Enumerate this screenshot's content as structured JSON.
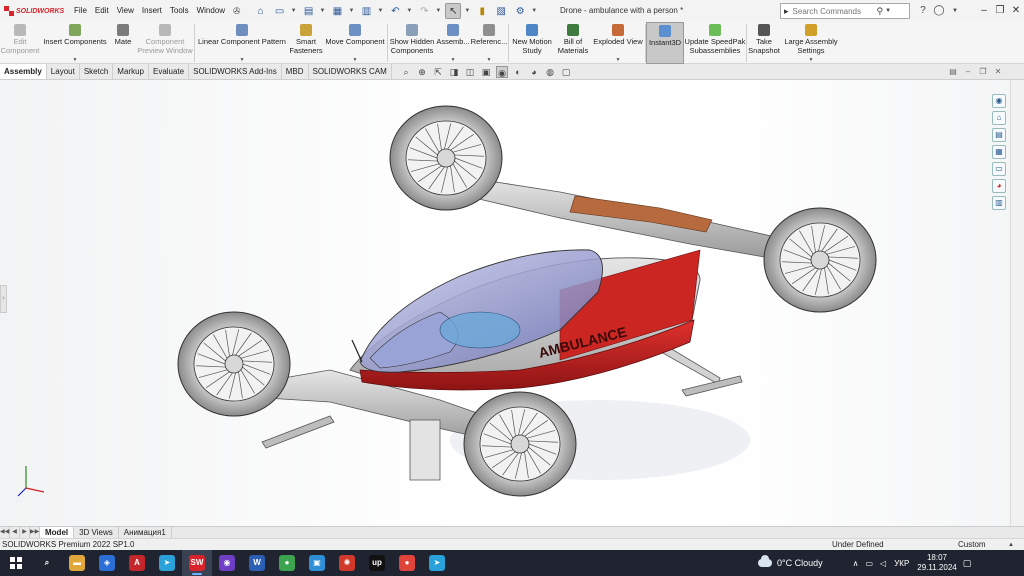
{
  "app": {
    "logo_text": "SOLIDWORKS",
    "document_title": "Drone - ambulance with a person *",
    "menu": [
      "File",
      "Edit",
      "View",
      "Insert",
      "Tools",
      "Window"
    ],
    "search_placeholder": "Search Commands"
  },
  "ribbon": [
    {
      "name": "edit-component-button",
      "label": "Edit\nComponent",
      "icon": "edit-component-icon",
      "color": "#b9b9b9",
      "disabled": true,
      "caret": false,
      "width": 40
    },
    {
      "name": "insert-components-button",
      "label": "Insert Components",
      "icon": "insert-components-icon",
      "color": "#7fa65a",
      "disabled": false,
      "caret": true,
      "width": 70
    },
    {
      "name": "mate-button",
      "label": "Mate",
      "icon": "mate-icon",
      "color": "#7c7c7c",
      "disabled": false,
      "caret": false,
      "width": 26
    },
    {
      "name": "component-preview-button",
      "label": "Component\nPreview Window",
      "icon": "preview-window-icon",
      "color": "#b9b9b9",
      "disabled": true,
      "caret": false,
      "width": 58
    },
    {
      "name": "linear-pattern-button",
      "label": "Linear Component Pattern",
      "icon": "linear-pattern-icon",
      "color": "#6f8fbf",
      "disabled": false,
      "caret": true,
      "width": 94
    },
    {
      "name": "smart-fasteners-button",
      "label": "Smart\nFasteners",
      "icon": "fasteners-icon",
      "color": "#c9a23a",
      "disabled": false,
      "caret": false,
      "width": 34
    },
    {
      "name": "move-component-button",
      "label": "Move Component",
      "icon": "move-component-icon",
      "color": "#6c8fc4",
      "disabled": false,
      "caret": true,
      "width": 64
    },
    {
      "name": "show-hidden-button",
      "label": "Show Hidden\nComponents",
      "icon": "show-hidden-icon",
      "color": "#8aa0b8",
      "disabled": false,
      "caret": false,
      "width": 48
    },
    {
      "name": "assembly-features-button",
      "label": "Assemb...",
      "icon": "assembly-features-icon",
      "color": "#6c8fc4",
      "disabled": false,
      "caret": true,
      "width": 34
    },
    {
      "name": "reference-geometry-button",
      "label": "Referenc...",
      "icon": "reference-geometry-icon",
      "color": "#8f8f8f",
      "disabled": false,
      "caret": true,
      "width": 38
    },
    {
      "name": "new-motion-study-button",
      "label": "New Motion\nStudy",
      "icon": "motion-study-icon",
      "color": "#4f86c6",
      "disabled": false,
      "caret": false,
      "width": 46
    },
    {
      "name": "bill-of-materials-button",
      "label": "Bill of\nMaterials",
      "icon": "bom-icon",
      "color": "#3f7a3f",
      "disabled": false,
      "caret": false,
      "width": 36
    },
    {
      "name": "exploded-view-button",
      "label": "Exploded View",
      "icon": "exploded-view-icon",
      "color": "#c66a3a",
      "disabled": false,
      "caret": true,
      "width": 54
    },
    {
      "name": "instant3d-button",
      "label": "Instant3D",
      "icon": "instant3d-icon",
      "color": "#5a8fd0",
      "disabled": false,
      "caret": false,
      "active": true,
      "width": 38
    },
    {
      "name": "update-speedpak-button",
      "label": "Update SpeedPak\nSubassemblies",
      "icon": "speedpak-icon",
      "color": "#6bbd57",
      "disabled": false,
      "caret": false,
      "width": 62
    },
    {
      "name": "take-snapshot-button",
      "label": "Take\nSnapshot",
      "icon": "snapshot-icon",
      "color": "#555",
      "disabled": false,
      "caret": false,
      "width": 34
    },
    {
      "name": "large-assembly-settings-button",
      "label": "Large Assembly\nSettings",
      "icon": "large-assembly-icon",
      "color": "#d1a02a",
      "disabled": false,
      "caret": true,
      "width": 60
    }
  ],
  "tabs": [
    "Assembly",
    "Layout",
    "Sketch",
    "Markup",
    "Evaluate",
    "SOLIDWORKS Add-Ins",
    "MBD",
    "SOLIDWORKS CAM"
  ],
  "active_tab": "Assembly",
  "model": {
    "livery_text": "AMBULANCE"
  },
  "bottom_tabs": [
    "Model",
    "3D Views",
    "Анимация1"
  ],
  "active_bottom_tab": "Model",
  "status": {
    "product": "SOLIDWORKS Premium 2022 SP1.0",
    "state": "Under Defined",
    "units": "Custom"
  },
  "taskbar": {
    "apps": [
      {
        "name": "search-taskbar-icon",
        "glyph": "⌕",
        "color": "transparent"
      },
      {
        "name": "file-explorer-icon",
        "glyph": "▬",
        "color": "#e0a83a"
      },
      {
        "name": "defender-icon",
        "glyph": "◈",
        "color": "#2b6fd6"
      },
      {
        "name": "acrobat-icon",
        "glyph": "A",
        "color": "#c3272b"
      },
      {
        "name": "telegram-icon",
        "glyph": "➤",
        "color": "#2aa1d8"
      },
      {
        "name": "solidworks-taskbar-icon",
        "glyph": "SW",
        "color": "#d9232a",
        "active": true
      },
      {
        "name": "app-purple-icon",
        "glyph": "◉",
        "color": "#6e3fc4"
      },
      {
        "name": "word-icon",
        "glyph": "W",
        "color": "#2b5fb4"
      },
      {
        "name": "chrome-icon",
        "glyph": "●",
        "color": "#3ca450"
      },
      {
        "name": "app-blue-icon",
        "glyph": "▣",
        "color": "#2e8fd6"
      },
      {
        "name": "app-red-icon",
        "glyph": "✺",
        "color": "#d13a2a"
      },
      {
        "name": "upwork-icon",
        "glyph": "up",
        "color": "#111111"
      },
      {
        "name": "chrome-2-icon",
        "glyph": "●",
        "color": "#e0433a"
      },
      {
        "name": "telegram-2-icon",
        "glyph": "➤",
        "color": "#2aa1d8"
      }
    ],
    "weather": "0°C Cloudy",
    "language": "УКР",
    "time": "18:07",
    "date": "29.11.2024"
  }
}
